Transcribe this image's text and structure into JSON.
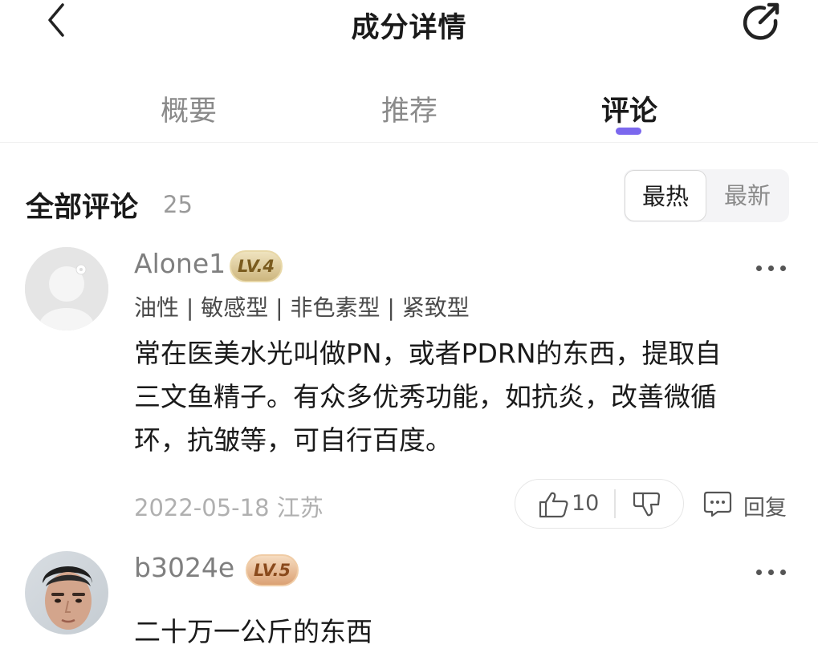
{
  "header": {
    "title": "成分详情",
    "back_icon": "chevron-left-icon",
    "share_icon": "share-icon"
  },
  "tabs": [
    {
      "label": "概要",
      "active": false
    },
    {
      "label": "推荐",
      "active": false
    },
    {
      "label": "评论",
      "active": true
    }
  ],
  "accent_color": "#7b68ee",
  "comments_section": {
    "title": "全部评论",
    "count": "25",
    "sort_options": [
      {
        "label": "最热",
        "active": true
      },
      {
        "label": "最新",
        "active": false
      }
    ]
  },
  "comments": [
    {
      "username": "Alone1",
      "level": "LV.4",
      "skin_tags": "油性 | 敏感型 | 非色素型 | 紧致型",
      "body": [
        "常在医美水光叫做PN，或者PDRN的东西，提取自",
        "三文鱼精子。有众多优秀功能，如抗炎，改善微循",
        "环，抗皱等，可自行百度。"
      ],
      "date": "2022-05-18 江苏",
      "likes": "10",
      "reply_label": "回复",
      "avatar": "default-avatar"
    },
    {
      "username": "b3024e",
      "level": "LV.5",
      "body": [
        "二十万一公斤的东西"
      ],
      "avatar": "photo-avatar"
    }
  ]
}
